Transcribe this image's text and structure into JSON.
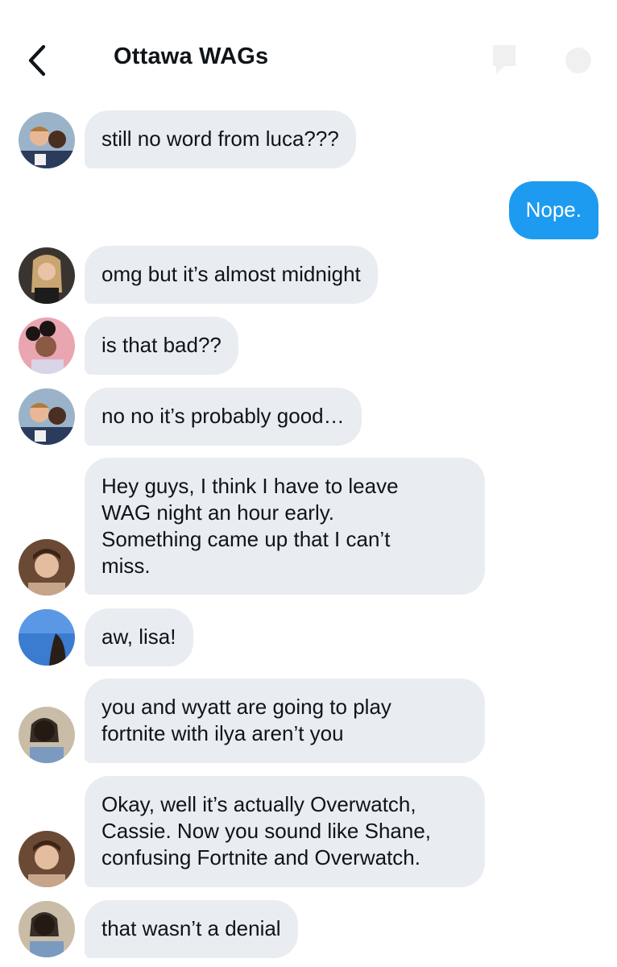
{
  "header": {
    "title": "Ottawa WAGs",
    "back_icon": "chevron-left-icon",
    "icons": [
      "flag-icon",
      "info-icon"
    ]
  },
  "colors": {
    "incoming_bubble": "#e9edf1",
    "outgoing_bubble": "#1d9bf0",
    "text": "#0f1419"
  },
  "messages": [
    {
      "sender": "other",
      "text": "still no word from luca???"
    },
    {
      "sender": "me",
      "text": "Nope."
    },
    {
      "sender": "other",
      "text": "omg but it’s almost midnight"
    },
    {
      "sender": "other",
      "text": "is that bad??"
    },
    {
      "sender": "other",
      "text": "no no it’s probably good…"
    },
    {
      "sender": "other",
      "text": "Hey guys, I think I have to leave\nWAG night an hour early.\nSomething came up that I can’t\nmiss."
    },
    {
      "sender": "other",
      "text": "aw, lisa!"
    },
    {
      "sender": "other",
      "text": "you and wyatt are going to play\nfortnite with ilya aren’t you"
    },
    {
      "sender": "other",
      "text": "Okay, well it’s actually Overwatch,\nCassie. Now you sound like Shane,\nconfusing Fortnite and Overwatch."
    },
    {
      "sender": "other",
      "text": "that wasn’t a denial"
    }
  ]
}
